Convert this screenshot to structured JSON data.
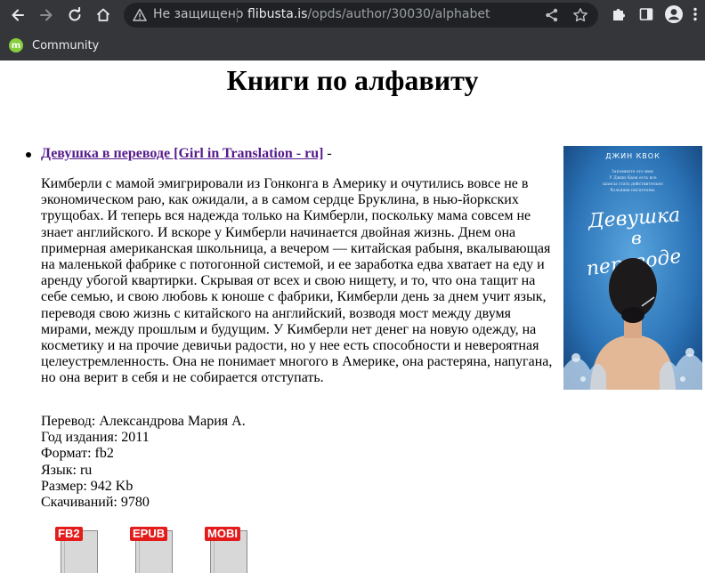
{
  "browser": {
    "security_label": "Не защищено",
    "url_host": "flibusta.is",
    "url_path": "/opds/author/30030/alphabet",
    "bookmarks": [
      {
        "label": "Community",
        "icon": "linux-mint-icon"
      }
    ]
  },
  "page": {
    "title": "Книги по алфавиту",
    "book": {
      "title_link": "Девушка в переводе [Girl in Translation - ru]",
      "title_suffix": " -",
      "annotation": "Кимберли с мамой эмигрировали из Гонконга в Америку и очутились вовсе не в экономическом раю, как ожидали, а в самом сердце Бруклина, в нью-йоркских трущобах. И теперь вся надежда только на Кимберли, поскольку мама совсем не знает английского. И вскоре у Кимберли начинается двойная жизнь. Днем она примерная американская школьница, а вечером — китайская рабыня, вкалывающая на маленькой фабрике с потогонной системой, и ее заработка едва хватает на еду и аренду убогой квартирки. Скрывая от всех и свою нищету, и то, что она тащит на себе семью, и свою любовь к юноше с фабрики, Кимберли день за днем учит язык, переводя свою жизнь с китайского на английский, возводя мост между двумя мирами, между прошлым и будущим. У Кимберли нет денег на новую одежду, на косметику и на прочие девичьи радости, но у нее есть способности и невероятная целеустремленность. Она не понимает многого в Америке, она растеряна, напугана, но она верит в себя и не собирается отступать.",
      "details": [
        "Перевод: Александрова Мария А.",
        "Год издания: 2011",
        "Формат: fb2",
        "Язык: ru",
        "Размер: 942 Kb",
        "Скачиваний: 9780"
      ],
      "cover": {
        "author": "ДЖИН КВОК",
        "tagline": "Запомните это имя. У Джин Квок есть все шансы стать действительно большим писателем.",
        "title_line1": "Девушка",
        "title_line2": "в",
        "title_line3": "переводе"
      },
      "downloads": [
        "FB2",
        "EPUB",
        "MOBI"
      ]
    }
  },
  "colors": {
    "chrome_bg": "#35363a",
    "omnibox_bg": "#202124",
    "link_visited": "#551a8b",
    "download_tag": "#e31b1b",
    "cover_blue": "#2a72b5"
  }
}
